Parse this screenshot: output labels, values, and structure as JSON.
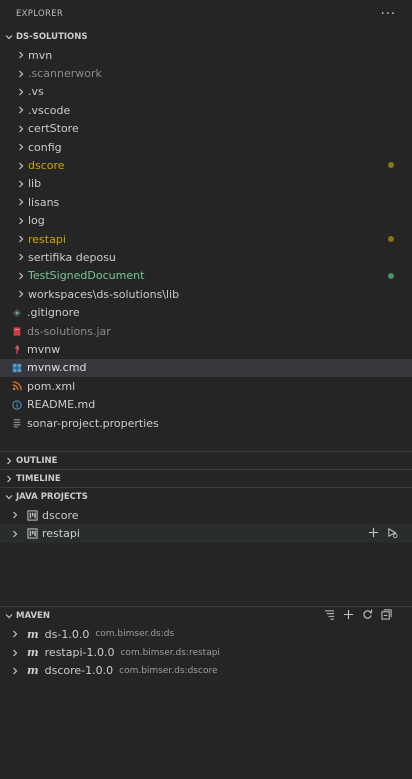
{
  "explorer": {
    "title": "EXPLORER",
    "more": "···",
    "workspace": "DS-SOLUTIONS",
    "folders": [
      {
        "label": "mvn"
      },
      {
        "label": ".scannerwork"
      },
      {
        "label": ".vs"
      },
      {
        "label": ".vscode"
      },
      {
        "label": "certStore"
      },
      {
        "label": "config"
      },
      {
        "label": "dscore"
      },
      {
        "label": "lib"
      },
      {
        "label": "lisans"
      },
      {
        "label": "log"
      },
      {
        "label": "restapi"
      },
      {
        "label": "sertifika deposu"
      },
      {
        "label": "TestSignedDocument"
      },
      {
        "label": "workspaces\\ds-solutions\\lib"
      }
    ],
    "files": [
      {
        "label": ".gitignore"
      },
      {
        "label": "ds-solutions.jar"
      },
      {
        "label": "mvnw"
      },
      {
        "label": "mvnw.cmd"
      },
      {
        "label": "pom.xml"
      },
      {
        "label": "README.md"
      },
      {
        "label": "sonar-project.properties"
      }
    ]
  },
  "outline": {
    "title": "OUTLINE"
  },
  "timeline": {
    "title": "TIMELINE"
  },
  "java_projects": {
    "title": "JAVA PROJECTS",
    "items": [
      {
        "label": "dscore"
      },
      {
        "label": "restapi"
      }
    ]
  },
  "maven": {
    "title": "MAVEN",
    "items": [
      {
        "label": "ds-1.0.0",
        "desc": "com.bimser.ds:ds"
      },
      {
        "label": "restapi-1.0.0",
        "desc": "com.bimser.ds:restapi"
      },
      {
        "label": "dscore-1.0.0",
        "desc": "com.bimser.ds:dscore"
      }
    ]
  },
  "colors": {
    "background": "#252526",
    "selected": "#37373d",
    "modified": "#cca700",
    "untracked": "#73c991",
    "dim": "#8b8b8b"
  }
}
